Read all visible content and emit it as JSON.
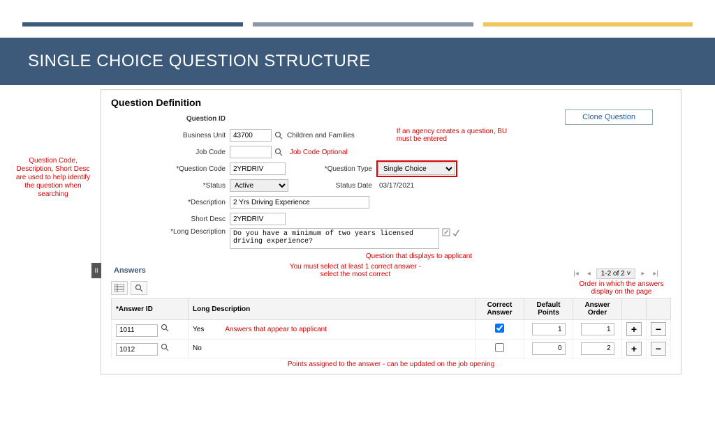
{
  "slide_title": "SINGLE CHOICE QUESTION STRUCTURE",
  "panel_title": "Question Definition",
  "labels": {
    "question_id": "Question ID",
    "business_unit": "Business Unit",
    "job_code": "Job Code",
    "question_code": "*Question Code",
    "status": "*Status",
    "description": "*Description",
    "short_desc": "Short Desc",
    "long_desc": "*Long Description",
    "question_type": "*Question Type",
    "status_date": "Status Date"
  },
  "values": {
    "business_unit": "43700",
    "bu_text": "Children and Families",
    "job_code": "",
    "question_code": "2YRDRIV",
    "status": "Active",
    "description": "2 Yrs Driving Experience",
    "short_desc": "2YRDRIV",
    "long_desc": "Do you have a minimum of two years licensed driving experience?",
    "question_type": "Single Choice",
    "status_date": "03/17/2021"
  },
  "buttons": {
    "clone": "Clone Question"
  },
  "notes": {
    "side_left": "Question Code, Description, Short Desc are used to help identify the question when searching",
    "bu_note": "If an agency creates a question, BU must be entered",
    "jobcode_note": "Job Code Optional",
    "longdesc_note": "Question that displays to applicant",
    "answers_note": "You must select at least 1 correct answer - select the most correct",
    "order_note": "Order in which the answers display on the page",
    "appear_note": "Answers that appear to applicant",
    "points_note": "Points assigned to the answer - can be updated on the job opening"
  },
  "answers_section": {
    "title": "Answers",
    "pager": "1-2 of 2",
    "columns": {
      "answer_id": "*Answer ID",
      "long_desc": "Long Description",
      "correct": "Correct Answer",
      "default_points": "Default Points",
      "order": "Answer Order"
    },
    "rows": [
      {
        "id": "1011",
        "desc": "Yes",
        "correct": true,
        "points": "1",
        "order": "1"
      },
      {
        "id": "1012",
        "desc": "No",
        "correct": false,
        "points": "0",
        "order": "2"
      }
    ]
  }
}
